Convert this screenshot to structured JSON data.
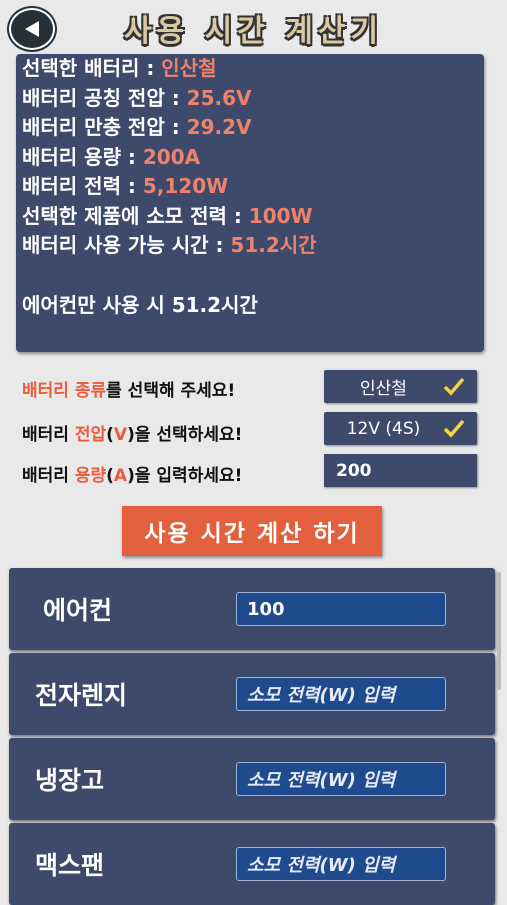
{
  "header": {
    "title": "사용 시간 계산기"
  },
  "info": {
    "battery_type_label": "선택한 배터리 : ",
    "battery_type_value": "인산철",
    "nominal_voltage_label": "배터리 공칭 전압 : ",
    "nominal_voltage_value": "25.6V",
    "full_voltage_label": "배터리 만충 전압 : ",
    "full_voltage_value": "29.2V",
    "capacity_label": "배터리 용량 : ",
    "capacity_value": "200A",
    "power_label": "배터리 전력 : ",
    "power_value": "5,120W",
    "consumption_label": "선택한 제품에 소모 전력 : ",
    "consumption_value": "100W",
    "runtime_label": "배터리 사용 가능 시간 : ",
    "runtime_value": "51.2시간",
    "summary": "에어컨만 사용 시 51.2시간"
  },
  "form": {
    "type_prompt": {
      "pre": "",
      "highlight": "배터리 종류",
      "post": "를 선택해 주세요!"
    },
    "type_value": "인산철",
    "voltage_prompt": {
      "pre": "배터리 ",
      "highlight": "전압",
      "paren_open": "(",
      "unit": "V",
      "paren_close": ")",
      "post": "을 선택하세요!"
    },
    "voltage_value": "12V (4S)",
    "capacity_prompt": {
      "pre": "배터리 ",
      "highlight": "용량",
      "paren_open": "(",
      "unit": "A",
      "paren_close": ")",
      "post": "을 입력하세요!"
    },
    "capacity_value": "200",
    "calc_button": "사용 시간 계산 하기"
  },
  "appliances": [
    {
      "name": "에어컨",
      "value": "100",
      "placeholder": "소모 전력(W) 입력"
    },
    {
      "name": "전자렌지",
      "value": "",
      "placeholder": "소모 전력(W) 입력"
    },
    {
      "name": "냉장고",
      "value": "",
      "placeholder": "소모 전력(W) 입력"
    },
    {
      "name": "맥스팬",
      "value": "",
      "placeholder": "소모 전력(W) 입력"
    }
  ],
  "colors": {
    "panel": "#3e4a6c",
    "accent": "#ee5a3c",
    "check": "#f2d44a"
  }
}
